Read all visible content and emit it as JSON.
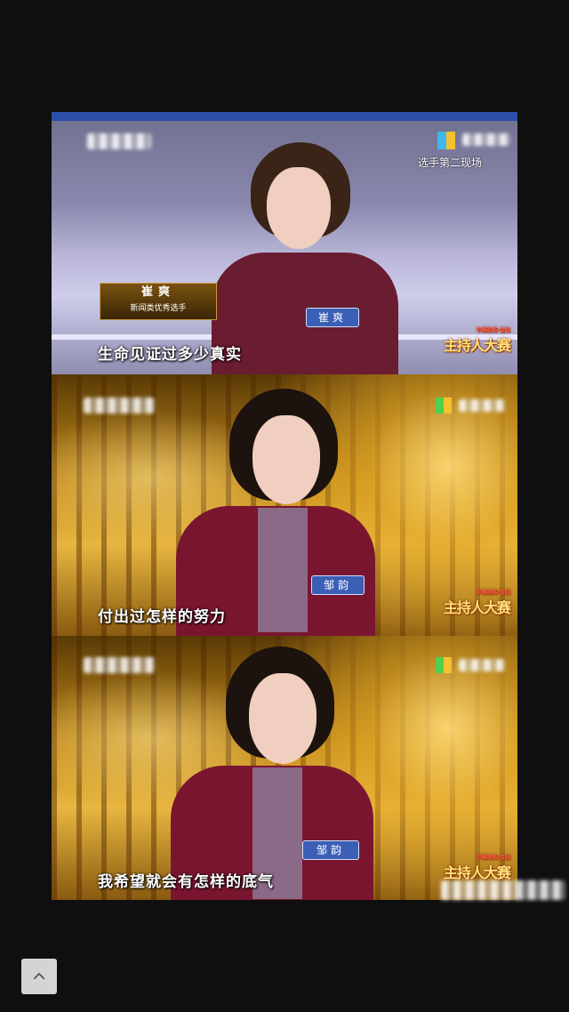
{
  "frames": [
    {
      "corner_label": "选手第二现场",
      "caption_name": "崔爽",
      "caption_role": "新闻类优秀选手",
      "nametag": "崔爽",
      "subtitle": "生命见证过多少真实",
      "logo_top": "中国政务·金标",
      "logo": "主持人大赛"
    },
    {
      "nametag": "邹韵",
      "subtitle": "付出过怎样的努力",
      "logo_top": "中国政务·金标",
      "logo": "主持人大赛"
    },
    {
      "nametag": "邹韵",
      "subtitle": "我希望就会有怎样的底气",
      "logo_top": "中国政务·金标",
      "logo": "主持人大赛"
    }
  ],
  "colors": {
    "page_bg": "#0f0f0f",
    "stage_blue": "#2d4ea8",
    "logo_gold": "#ffe27a",
    "blazer_red": "#7a1530"
  },
  "icons": {
    "scroll_top": "chevron-up-icon"
  }
}
